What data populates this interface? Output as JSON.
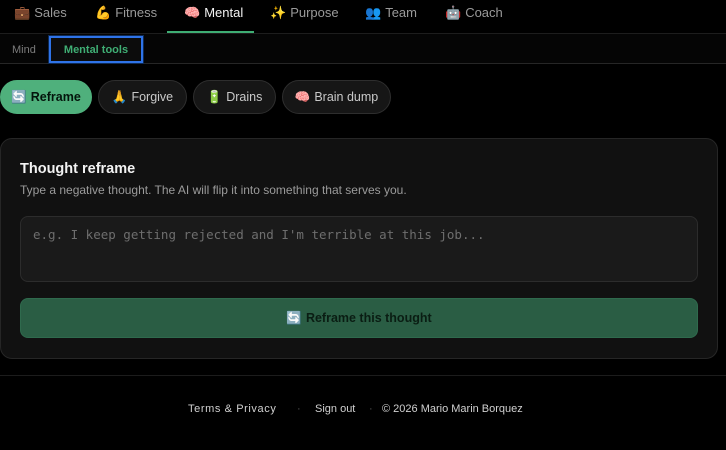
{
  "topnav": {
    "tabs": [
      {
        "icon": "💼",
        "label": "Sales"
      },
      {
        "icon": "💪",
        "label": "Fitness"
      },
      {
        "icon": "🧠",
        "label": "Mental"
      },
      {
        "icon": "✨",
        "label": "Purpose"
      },
      {
        "icon": "👥",
        "label": "Team"
      },
      {
        "icon": "🤖",
        "label": "Coach"
      }
    ],
    "active": "Mental"
  },
  "subnav": {
    "items": [
      "Mind",
      "Mental tools"
    ],
    "active": "Mental tools"
  },
  "tools": [
    {
      "icon": "🔄",
      "label": "Reframe",
      "active": true
    },
    {
      "icon": "🙏",
      "label": "Forgive"
    },
    {
      "icon": "🔋",
      "label": "Drains"
    },
    {
      "icon": "🧠",
      "label": "Brain dump"
    }
  ],
  "card": {
    "title": "Thought reframe",
    "subtitle": "Type a negative thought. The AI will flip it into something that serves you.",
    "input_value": "",
    "input_placeholder": "e.g. I keep getting rejected and I'm terrible at this job...",
    "button_icon": "🔄",
    "button_label": "Reframe this thought"
  },
  "footer": {
    "terms": "Terms & Privacy",
    "separator": "·",
    "signout": "Sign out",
    "copyright": "© 2026 Mario Marin Borquez"
  },
  "colors": {
    "accent": "#3fae74",
    "background": "#000000",
    "card": "#111111",
    "focus_outline": "#2f73e8"
  }
}
